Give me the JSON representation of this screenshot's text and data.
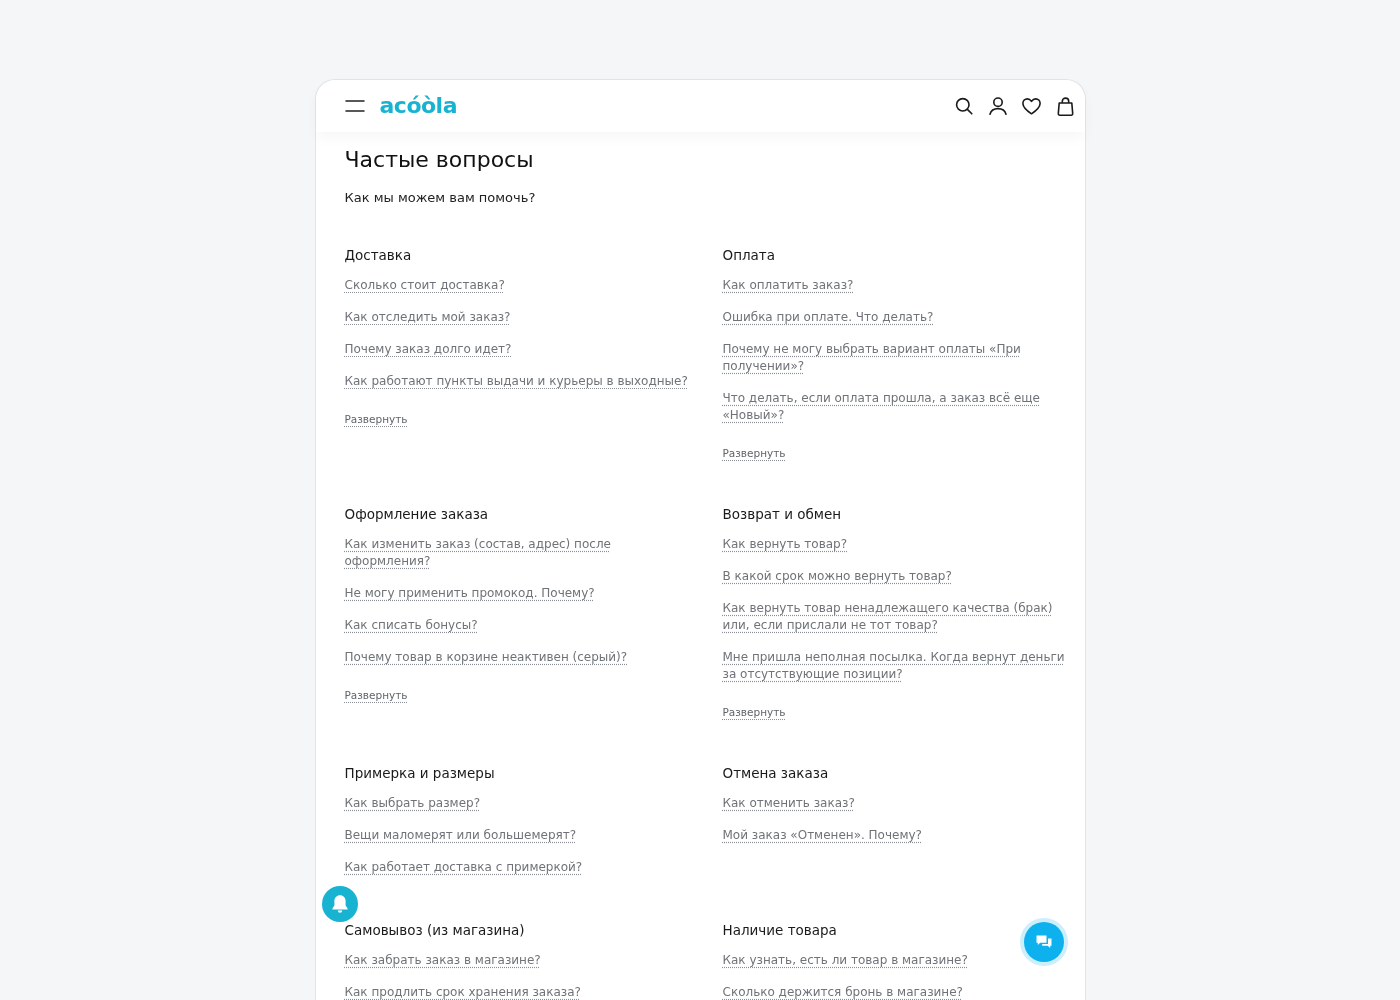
{
  "header": {
    "logo": "acóòla"
  },
  "page": {
    "title": "Частые вопросы",
    "subtitle": "Как мы можем вам помочь?"
  },
  "sections": [
    {
      "title": "Доставка",
      "questions": [
        "Сколько стоит доставка?",
        "Как отследить мой заказ?",
        "Почему заказ долго идет?",
        "Как работают пункты выдачи и курьеры в выходные?"
      ],
      "expand_link": "Развернуть"
    },
    {
      "title": "Оплата",
      "questions": [
        "Как оплатить заказ?",
        "Ошибка при оплате. Что делать?",
        "Почему не могу выбрать вариант оплаты «При получении»?",
        "Что делать, если оплата прошла, а заказ всё еще «Новый»?"
      ],
      "expand_link": "Развернуть"
    },
    {
      "title": "Оформление заказа",
      "questions": [
        "Как изменить заказ (состав, адрес) после оформления?",
        "Не могу применить промокод. Почему?",
        "Как списать бонусы?",
        "Почему товар в корзине неактивен (серый)?"
      ],
      "expand_link": "Развернуть"
    },
    {
      "title": "Возврат и обмен",
      "questions": [
        "Как вернуть товар?",
        "В какой срок можно вернуть товар?",
        "Как вернуть товар ненадлежащего качества (брак) или, если прислали не тот товар?",
        "Мне пришла неполная посылка. Когда вернут деньги за отсутствующие позиции?"
      ],
      "expand_link": "Развернуть"
    },
    {
      "title": "Примерка и размеры",
      "questions": [
        "Как выбрать размер?",
        "Вещи маломерят или большемерят?",
        "Как работает доставка с примеркой?"
      ]
    },
    {
      "title": "Отмена заказа",
      "questions": [
        "Как отменить заказ?",
        "Мой заказ «Отменен». Почему?"
      ]
    },
    {
      "title": "Самовывоз (из магазина)",
      "questions": [
        "Как забрать заказ в магазине?",
        "Как продлить срок хранения заказа?"
      ]
    },
    {
      "title": "Наличие товара",
      "questions": [
        "Как узнать, есть ли товар в магазине?",
        "Сколько держится бронь в магазине?"
      ]
    }
  ]
}
